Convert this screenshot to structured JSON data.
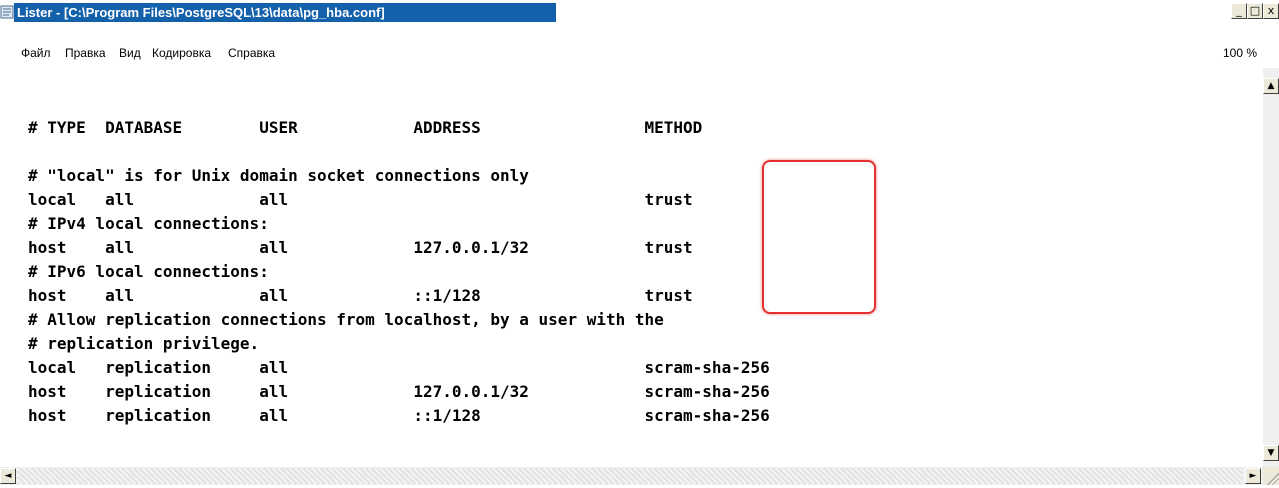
{
  "window": {
    "title": "Lister - [C:\\Program Files\\PostgreSQL\\13\\data\\pg_hba.conf]",
    "controls": {
      "minimize": "_",
      "maximize": "□",
      "close": "x"
    }
  },
  "menu": {
    "items": [
      "Файл",
      "Правка",
      "Вид",
      "Кодировка",
      "Справка"
    ],
    "zoom": "100 %"
  },
  "file": {
    "lines": [
      "# TYPE  DATABASE        USER            ADDRESS                 METHOD",
      "",
      "# \"local\" is for Unix domain socket connections only",
      "local   all             all                                     trust",
      "# IPv4 local connections:",
      "host    all             all             127.0.0.1/32            trust",
      "# IPv6 local connections:",
      "host    all             all             ::1/128                 trust",
      "# Allow replication connections from localhost, by a user with the",
      "# replication privilege.",
      "local   replication     all                                     scram-sha-256",
      "host    replication     all             127.0.0.1/32            scram-sha-256",
      "host    replication     all             ::1/128                 scram-sha-256"
    ]
  },
  "scrollbar": {
    "up": "▲",
    "down": "▼",
    "left": "◄",
    "right": "►"
  }
}
